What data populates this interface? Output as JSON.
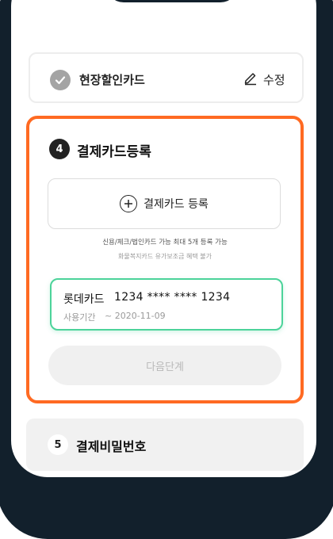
{
  "step3": {
    "title": "현장할인카드",
    "edit_label": "수정",
    "check_icon": "checkmark-icon"
  },
  "step4": {
    "number": "4",
    "title": "결제카드등록",
    "add_card_label": "결제카드 등록",
    "note_primary": "신용/체크/법인카드 가능 최대 5개 등록 가능",
    "note_secondary": "화물복지카드 유가보조금 혜택 불가",
    "card": {
      "name": "롯데카드",
      "number": "1234 **** **** 1234",
      "period_label": "사용기간",
      "period_value": "~ 2020-11-09"
    },
    "next_label": "다음단계"
  },
  "step5": {
    "number": "5",
    "title": "결제비밀번호"
  },
  "colors": {
    "accent": "#ff6a22",
    "selected_border": "#4cd39a",
    "frame": "#12202c",
    "done_check": "#a4a4a4"
  }
}
